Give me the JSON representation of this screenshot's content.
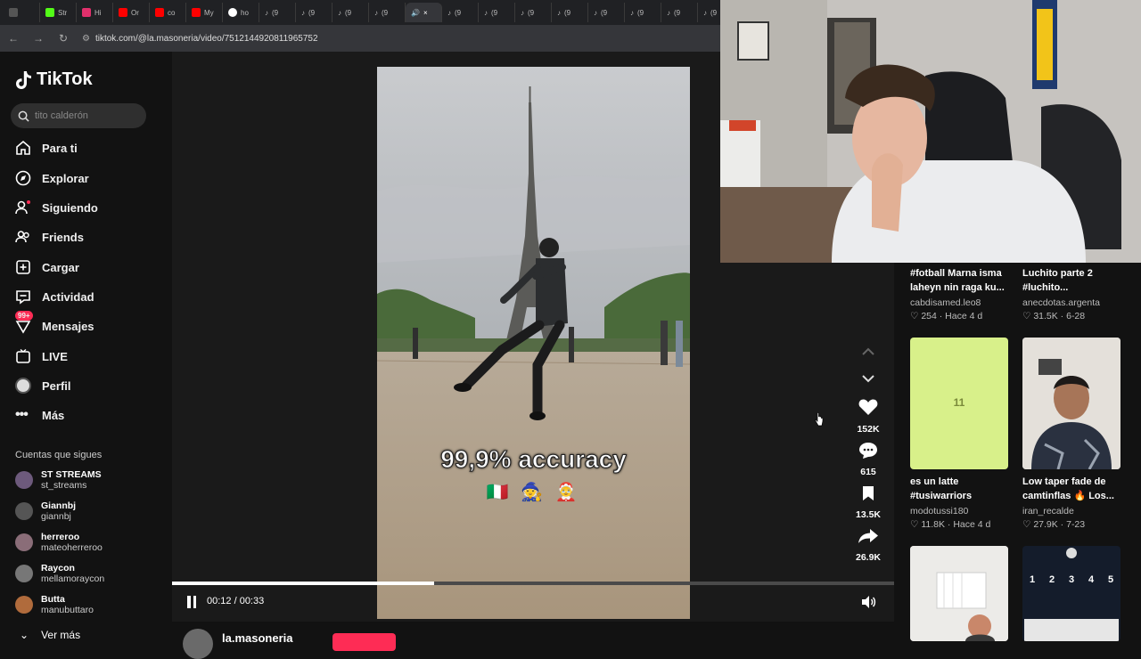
{
  "browser": {
    "tabs": [
      {
        "label": "",
        "icon": "app-icon",
        "color": "#666"
      },
      {
        "label": "Str",
        "icon": "kick-icon",
        "color": "#53fc18"
      },
      {
        "label": "Hi",
        "icon": "instagram-icon",
        "color": "#e1306c"
      },
      {
        "label": "Or",
        "icon": "youtube-icon",
        "color": "#ff0000"
      },
      {
        "label": "co",
        "icon": "youtube-icon",
        "color": "#ff0000"
      },
      {
        "label": "My",
        "icon": "youtube-icon",
        "color": "#ff0000"
      },
      {
        "label": "ho",
        "icon": "google-icon",
        "color": "#4285f4"
      },
      {
        "label": "(9",
        "icon": "tiktok-icon",
        "color": "#fff"
      },
      {
        "label": "(9",
        "icon": "tiktok-icon",
        "color": "#fff"
      },
      {
        "label": "(9",
        "icon": "tiktok-icon",
        "color": "#fff"
      },
      {
        "label": "(9",
        "icon": "tiktok-icon",
        "color": "#fff"
      },
      {
        "label": "×",
        "icon": "speaker-icon",
        "color": "#fff",
        "active": true
      },
      {
        "label": "(9",
        "icon": "tiktok-icon",
        "color": "#fff"
      },
      {
        "label": "(9",
        "icon": "tiktok-icon",
        "color": "#fff"
      },
      {
        "label": "(9",
        "icon": "tiktok-icon",
        "color": "#fff"
      },
      {
        "label": "(9",
        "icon": "tiktok-icon",
        "color": "#fff"
      },
      {
        "label": "(9",
        "icon": "tiktok-icon",
        "color": "#fff"
      },
      {
        "label": "(9",
        "icon": "tiktok-icon",
        "color": "#fff"
      },
      {
        "label": "(9",
        "icon": "tiktok-icon",
        "color": "#fff"
      },
      {
        "label": "(9",
        "icon": "tiktok-icon",
        "color": "#fff"
      }
    ],
    "url": "tiktok.com/@la.masoneria/video/7512144920811965752"
  },
  "sidebar": {
    "logo": "TikTok",
    "search_placeholder": "tito calderón",
    "nav": [
      {
        "label": "Para ti",
        "icon": "home-icon"
      },
      {
        "label": "Explorar",
        "icon": "compass-icon"
      },
      {
        "label": "Siguiendo",
        "icon": "following-icon"
      },
      {
        "label": "Friends",
        "icon": "friends-icon"
      },
      {
        "label": "Cargar",
        "icon": "upload-icon"
      },
      {
        "label": "Actividad",
        "icon": "activity-icon"
      },
      {
        "label": "Mensajes",
        "icon": "messages-icon",
        "badge": "99+"
      },
      {
        "label": "LIVE",
        "icon": "live-icon"
      },
      {
        "label": "Perfil",
        "icon": "profile-icon"
      },
      {
        "label": "Más",
        "icon": "more-icon"
      }
    ],
    "following_title": "Cuentas que sigues",
    "accounts": [
      {
        "name": "ST STREAMS",
        "handle": "st_streams"
      },
      {
        "name": "Giannbj",
        "handle": "giannbj"
      },
      {
        "name": "herreroo",
        "handle": "mateoherreroo"
      },
      {
        "name": "Raycon",
        "handle": "mellamoraycon"
      },
      {
        "name": "Butta",
        "handle": "manubuttaro"
      }
    ],
    "see_more": "Ver más"
  },
  "player": {
    "caption": "99,9% accuracy",
    "emojis": "🇮🇹 🧙 🤶",
    "time": "00:12 / 00:33",
    "progress": 0.363,
    "author": "la.masoneria"
  },
  "actions": {
    "likes": "152K",
    "comments": "615",
    "saves": "13.5K",
    "shares": "26.9K"
  },
  "related": [
    {
      "title": "#fotball Marna isma laheyn nin raga ku...",
      "user": "cabdisamed.leo8",
      "meta": "♡ 254 · Hace 4 d"
    },
    {
      "title": "Luchito parte 2 #luchito...",
      "user": "anecdotas.argenta",
      "meta": "♡ 31.5K · 6-28"
    },
    {
      "title": "es un latte #tusiwarriors",
      "user": "modotussi180",
      "meta": "♡ 11.8K · Hace 4 d",
      "thumb_text": "11"
    },
    {
      "title": "Low taper fade de camtinflas 🔥 Los...",
      "user": "iran_recalde",
      "meta": "♡ 27.9K · 7-23"
    },
    {
      "thumb_numbers": [
        "1",
        "2",
        "3",
        "4",
        "5"
      ]
    }
  ]
}
